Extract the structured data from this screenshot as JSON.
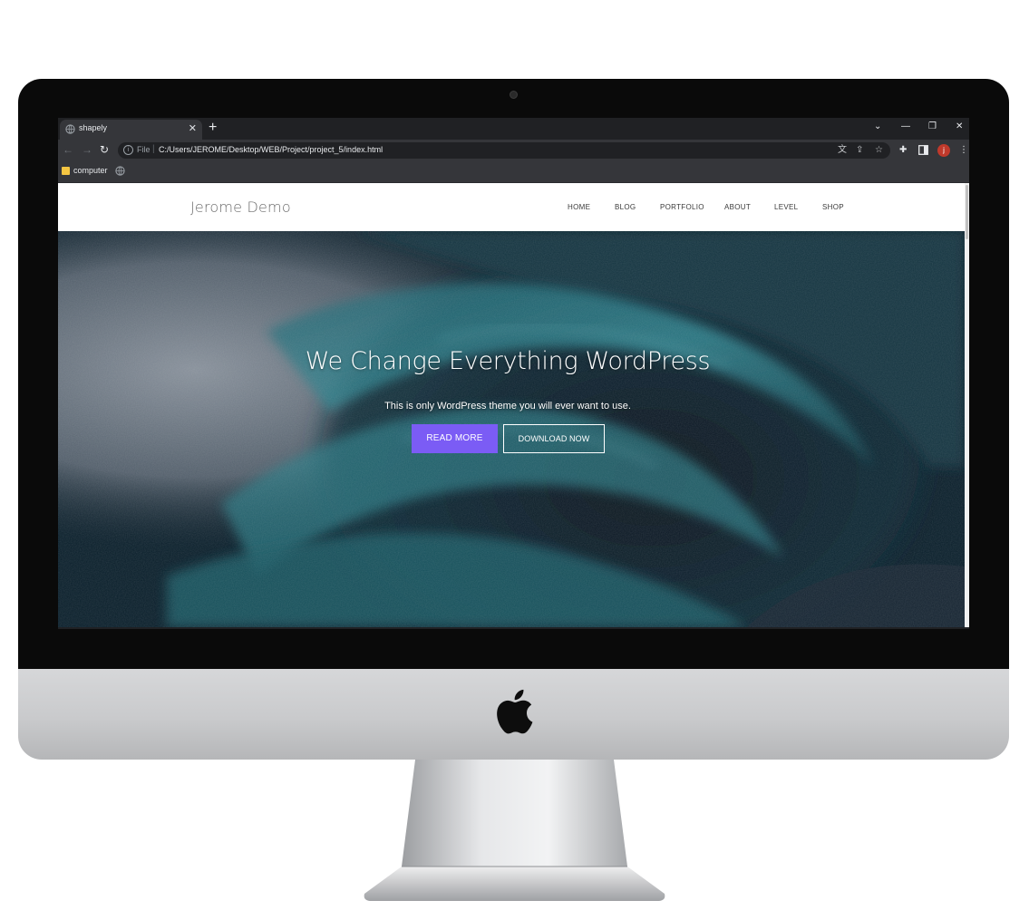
{
  "browser": {
    "tab_title": "shapely",
    "tab_close": "✕",
    "new_tab": "+",
    "window_controls": [
      "⌄",
      "—",
      "❐",
      "✕"
    ],
    "url_scheme": "File",
    "url": "C:/Users/JEROME/Desktop/WEB/Project/project_5/index.html",
    "profile_initial": "j",
    "bookmarks": [
      {
        "label": "computer"
      }
    ],
    "icons": [
      "back-arrow-icon",
      "forward-arrow-icon",
      "reload-icon",
      "info-icon",
      "translate-icon",
      "share-icon",
      "bookmark-star-icon",
      "extensions-puzzle-icon",
      "side-panel-icon",
      "kebab-menu-icon"
    ]
  },
  "site": {
    "brand": "Jerome Demo",
    "nav": [
      "HOME",
      "BLOG",
      "PORTFOLIO",
      "ABOUT",
      "LEVEL",
      "SHOP"
    ],
    "hero": {
      "title": "We Change Everything WordPress",
      "subtitle": "This is only WordPress theme you will ever want to use.",
      "primary_button": "READ MORE",
      "secondary_button": "DOWNLOAD NOW"
    }
  },
  "colors": {
    "accent": "#7b5cf5",
    "chrome_dark": "#202124",
    "chrome_toolbar": "#35363a",
    "wave_teal": "#2f8a96"
  }
}
